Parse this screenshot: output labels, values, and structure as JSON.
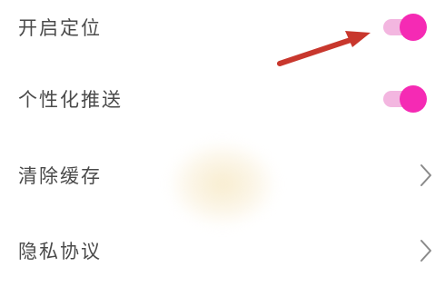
{
  "settings": {
    "items": [
      {
        "label": "开启定位",
        "control": "toggle",
        "state": "on"
      },
      {
        "label": "个性化推送",
        "control": "toggle",
        "state": "on"
      },
      {
        "label": "清除缓存",
        "control": "chevron",
        "icon": "chevron-right-icon"
      },
      {
        "label": "隐私协议",
        "control": "chevron",
        "icon": "chevron-right-icon"
      }
    ]
  },
  "colors": {
    "accent": "#f52ab4",
    "accent_track": "#f3b6e0",
    "annotation_arrow": "#c8372d",
    "text": "#4a4a4a",
    "chevron": "#8a8a8a"
  },
  "annotation": {
    "icon": "red-arrow-icon",
    "points_to": "开启定位 toggle"
  }
}
